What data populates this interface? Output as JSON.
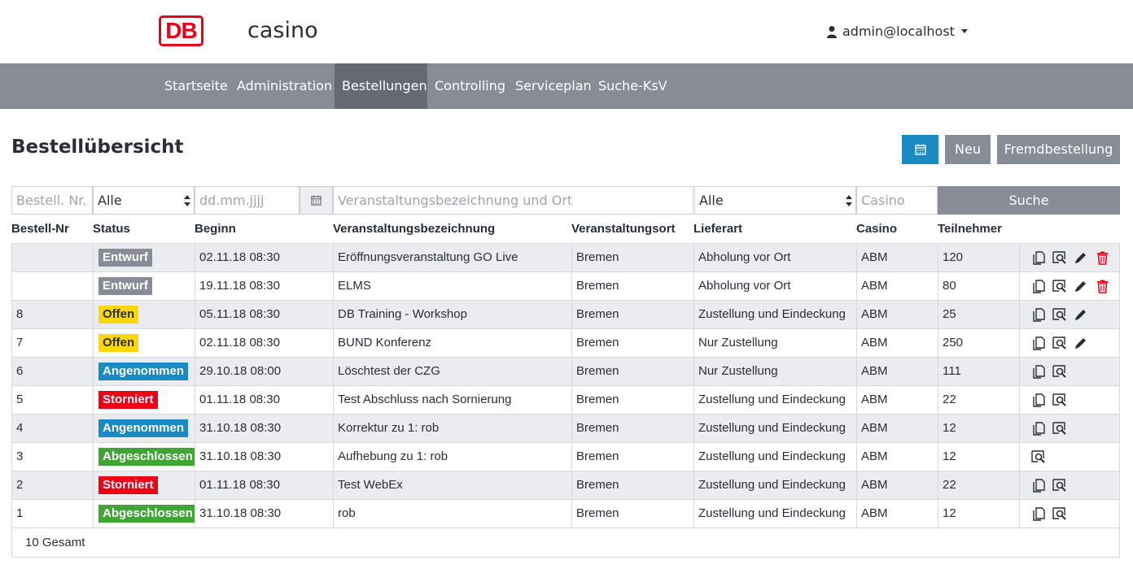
{
  "header": {
    "logo_text": "DB",
    "app_title": "casino",
    "user": "admin@localhost"
  },
  "nav": {
    "items": [
      "Startseite",
      "Administration",
      "Bestellungen",
      "Controlling",
      "Serviceplan",
      "Suche-KsV"
    ],
    "active": "Bestellungen"
  },
  "page": {
    "title": "Bestellübersicht",
    "btn_neu": "Neu",
    "btn_fremd": "Fremdbestellung"
  },
  "filters": {
    "bestell_placeholder": "Bestell. Nr.",
    "status_value": "Alle",
    "date_placeholder": "dd.mm.jjjj",
    "veranstaltung_placeholder": "Veranstaltungsbezeichnung und Ort",
    "lieferart_value": "Alle",
    "casino_placeholder": "Casino",
    "search_label": "Suche"
  },
  "table": {
    "headers": [
      "Bestell-Nr",
      "Status",
      "Beginn",
      "Veranstaltungsbezeichnung",
      "Veranstaltungsort",
      "Lieferart",
      "Casino",
      "Teilnehmer"
    ],
    "rows": [
      {
        "nr": "",
        "status": "Entwurf",
        "beginn": "02.11.18 08:30",
        "bezeichnung": "Eröffnungsveranstaltung GO Live",
        "ort": "Bremen",
        "lieferart": "Abholung vor Ort",
        "casino": "ABM",
        "teilnehmer": "120",
        "actions": [
          "copy-icon",
          "view-icon",
          "edit-icon",
          "delete-icon"
        ]
      },
      {
        "nr": "",
        "status": "Entwurf",
        "beginn": "19.11.18 08:30",
        "bezeichnung": "ELMS",
        "ort": "Bremen",
        "lieferart": "Abholung vor Ort",
        "casino": "ABM",
        "teilnehmer": "80",
        "actions": [
          "copy-icon",
          "view-icon",
          "edit-icon",
          "delete-icon"
        ]
      },
      {
        "nr": "8",
        "status": "Offen",
        "beginn": "05.11.18 08:30",
        "bezeichnung": "DB Training - Workshop",
        "ort": "Bremen",
        "lieferart": "Zustellung und Eindeckung",
        "casino": "ABM",
        "teilnehmer": "25",
        "actions": [
          "copy-icon",
          "view-icon",
          "edit-icon"
        ]
      },
      {
        "nr": "7",
        "status": "Offen",
        "beginn": "02.11.18 08:30",
        "bezeichnung": "BUND Konferenz",
        "ort": "Bremen",
        "lieferart": "Nur Zustellung",
        "casino": "ABM",
        "teilnehmer": "250",
        "actions": [
          "copy-icon",
          "view-icon",
          "edit-icon"
        ]
      },
      {
        "nr": "6",
        "status": "Angenommen",
        "beginn": "29.10.18 08:00",
        "bezeichnung": "Löschtest der CZG",
        "ort": "Bremen",
        "lieferart": "Nur Zustellung",
        "casino": "ABM",
        "teilnehmer": "111",
        "actions": [
          "copy-icon",
          "view-icon"
        ]
      },
      {
        "nr": "5",
        "status": "Storniert",
        "beginn": "01.11.18 08:30",
        "bezeichnung": "Test Abschluss nach Sornierung",
        "ort": "Bremen",
        "lieferart": "Zustellung und Eindeckung",
        "casino": "ABM",
        "teilnehmer": "22",
        "actions": [
          "copy-icon",
          "view-icon"
        ]
      },
      {
        "nr": "4",
        "status": "Angenommen",
        "beginn": "31.10.18 08:30",
        "bezeichnung": "Korrektur zu 1: rob",
        "ort": "Bremen",
        "lieferart": "Zustellung und Eindeckung",
        "casino": "ABM",
        "teilnehmer": "12",
        "actions": [
          "copy-icon",
          "view-icon"
        ]
      },
      {
        "nr": "3",
        "status": "Abgeschlossen",
        "beginn": "31.10.18 08:30",
        "bezeichnung": "Aufhebung zu 1: rob",
        "ort": "Bremen",
        "lieferart": "Zustellung und Eindeckung",
        "casino": "ABM",
        "teilnehmer": "12",
        "actions": [
          "view-icon"
        ]
      },
      {
        "nr": "2",
        "status": "Storniert",
        "beginn": "01.11.18 08:30",
        "bezeichnung": "Test WebEx",
        "ort": "Bremen",
        "lieferart": "Zustellung und Eindeckung",
        "casino": "ABM",
        "teilnehmer": "22",
        "actions": [
          "copy-icon",
          "view-icon"
        ]
      },
      {
        "nr": "1",
        "status": "Abgeschlossen",
        "beginn": "31.10.18 08:30",
        "bezeichnung": "rob",
        "ort": "Bremen",
        "lieferart": "Zustellung und Eindeckung",
        "casino": "ABM",
        "teilnehmer": "12",
        "actions": [
          "copy-icon",
          "view-icon"
        ]
      }
    ],
    "footer": "10 Gesamt"
  },
  "colors": {
    "brand_red": "#ec0016",
    "nav_bg": "#878c96",
    "nav_active": "#646973",
    "primary_blue": "#1a8ac2",
    "status_entwurf": "#878c96",
    "status_offen": "#ffd800",
    "status_angenommen": "#1a8ac2",
    "status_storniert": "#ec0016",
    "status_abgeschlossen": "#3fa535"
  }
}
